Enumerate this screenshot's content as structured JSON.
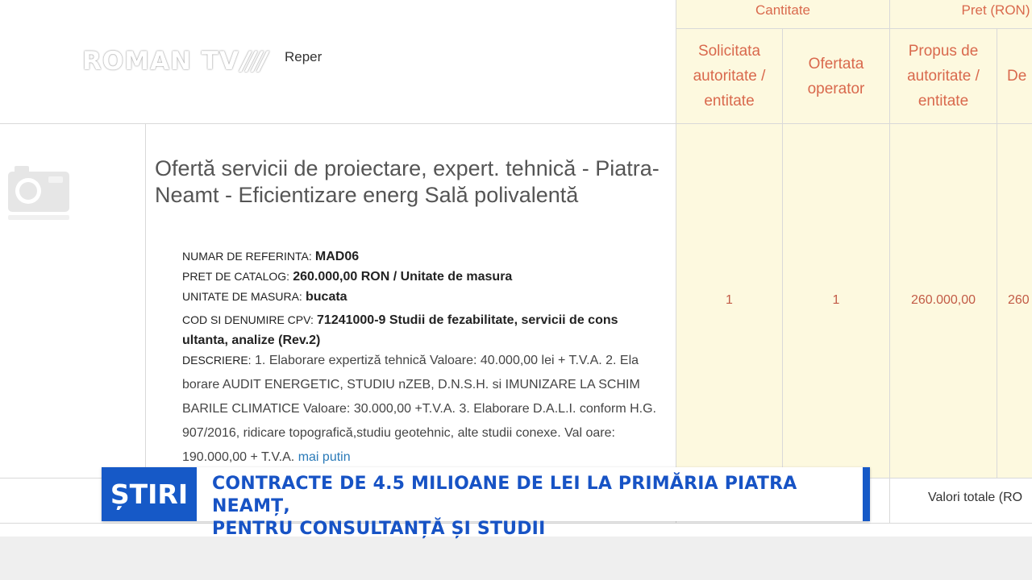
{
  "header": {
    "logo_text": "ROMAN TV",
    "logo_slashes": "////",
    "reper_label": "Reper",
    "cantitate_label": "Cantitate",
    "pret_label": "Pret (RON)",
    "columns": {
      "solicitata": [
        "Solicitata",
        "autoritate /",
        "entitate"
      ],
      "ofertata": [
        "Ofertata",
        "operator"
      ],
      "propus": [
        "Propus de",
        "autoritate /",
        "entitate"
      ],
      "de": [
        "De"
      ]
    }
  },
  "item": {
    "image_icon": "camera-icon",
    "title": "Ofertă servicii de proiectare, expert. tehnică - Piatra-Neamt - Eficientizare energ Sală polivalentă",
    "fields": [
      {
        "label": "NUMAR DE REFERINTA:",
        "value": "MAD06"
      },
      {
        "label": "PRET DE CATALOG:",
        "value": "260.000,00  RON / Unitate de masura"
      },
      {
        "label": "UNITATE DE MASURA:",
        "value": "bucata"
      },
      {
        "label": "COD SI DENUMIRE CPV:",
        "value": "71241000-9 Studii de fezabilitate, servicii de cons ultanta, analize (Rev.2)"
      }
    ],
    "description_label": "DESCRIERE:",
    "description_text": "1. Elaborare expertiză tehnică Valoare: 40.000,00 lei + T.V.A. 2. Ela borare AUDIT ENERGETIC, STUDIU nZEB, D.N.S.H. si IMUNIZARE LA SCHIM BARILE CLIMATICE Valoare: 30.000,00 +T.V.A. 3. Elaborare D.A.L.I. conform H.G. 907/2016, ridicare topografică,studiu geotehnic, alte studii conexe. Val oare: 190.000,00 + T.V.A.",
    "less_link": "mai putin",
    "qty_requested": "1",
    "qty_offered": "1",
    "price_proposed": "260.000,00",
    "price_de": "260"
  },
  "totals_label": "Valori totale (RO",
  "ticker": {
    "tag": "ȘTIRI",
    "headline_line1": "CONTRACTE DE 4.5 MILIOANE DE LEI LA PRIMĂRIA PIATRA NEAMȚ,",
    "headline_line2": "PENTRU CONSULTANȚĂ ȘI STUDII"
  },
  "colors": {
    "accent_orange": "#d9694d",
    "yellow_bg": "#fdf9df",
    "ticker_blue": "#1659c7",
    "link_blue": "#2a7ab8"
  }
}
